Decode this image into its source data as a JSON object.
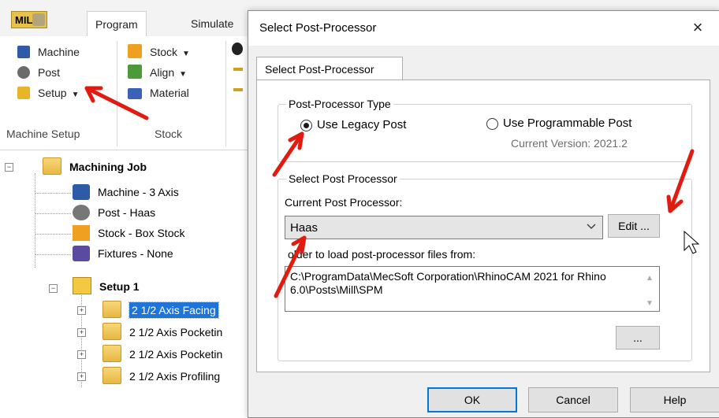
{
  "app": {
    "mill_badge": "MILL",
    "tabs": [
      "Program",
      "Simulate"
    ],
    "ribbon": {
      "machine_setup": {
        "items": [
          "Machine",
          "Post",
          "Setup"
        ],
        "label": "Machine Setup"
      },
      "stock": {
        "items": [
          "Stock",
          "Align",
          "Material"
        ],
        "label": "Stock"
      }
    },
    "tree": {
      "root": "Machining Job",
      "children": [
        "Machine - 3 Axis",
        "Post - Haas",
        "Stock - Box Stock",
        "Fixtures - None"
      ],
      "setup": "Setup 1",
      "operations": [
        "2 1/2 Axis Facing",
        "2 1/2 Axis Pocketin",
        "2 1/2 Axis Pocketin",
        "2 1/2 Axis Profiling"
      ]
    }
  },
  "dialog": {
    "title": "Select Post-Processor",
    "close": "×",
    "tab": "Select Post-Processor",
    "post_type_group": "Post-Processor Type",
    "legacy_label": "Use Legacy Post",
    "programmable_label": "Use Programmable Post",
    "current_version": "Current Version: 2021.2",
    "select_group": "Select Post Processor",
    "current_label": "Current Post Processor:",
    "current_value": "Haas",
    "edit_button": "Edit ...",
    "folder_label": "older to load post-processor files from:",
    "folder_path": "C:\\ProgramData\\MecSoft Corporation\\RhinoCAM 2021 for Rhino 6.0\\Posts\\Mill\\SPM",
    "browse_button": "...",
    "ok_button": "OK",
    "cancel_button": "Cancel",
    "help_button": "Help"
  },
  "colors": {
    "accent": "#0078d7",
    "selection": "#1e74d8",
    "annotation": "#e11b0f"
  }
}
